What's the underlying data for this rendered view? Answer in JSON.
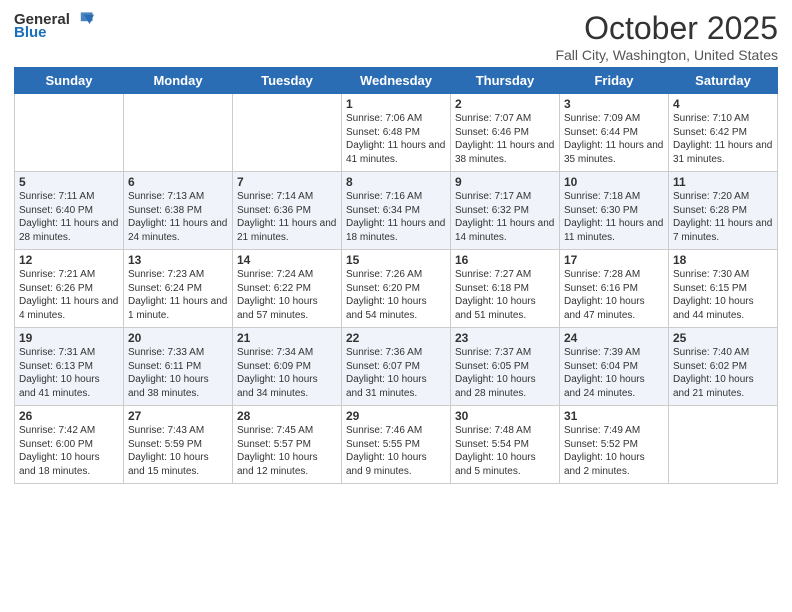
{
  "header": {
    "logo_general": "General",
    "logo_blue": "Blue",
    "month": "October 2025",
    "location": "Fall City, Washington, United States"
  },
  "weekdays": [
    "Sunday",
    "Monday",
    "Tuesday",
    "Wednesday",
    "Thursday",
    "Friday",
    "Saturday"
  ],
  "weeks": [
    [
      {
        "day": "",
        "info": ""
      },
      {
        "day": "",
        "info": ""
      },
      {
        "day": "",
        "info": ""
      },
      {
        "day": "1",
        "info": "Sunrise: 7:06 AM\nSunset: 6:48 PM\nDaylight: 11 hours and 41 minutes."
      },
      {
        "day": "2",
        "info": "Sunrise: 7:07 AM\nSunset: 6:46 PM\nDaylight: 11 hours and 38 minutes."
      },
      {
        "day": "3",
        "info": "Sunrise: 7:09 AM\nSunset: 6:44 PM\nDaylight: 11 hours and 35 minutes."
      },
      {
        "day": "4",
        "info": "Sunrise: 7:10 AM\nSunset: 6:42 PM\nDaylight: 11 hours and 31 minutes."
      }
    ],
    [
      {
        "day": "5",
        "info": "Sunrise: 7:11 AM\nSunset: 6:40 PM\nDaylight: 11 hours and 28 minutes."
      },
      {
        "day": "6",
        "info": "Sunrise: 7:13 AM\nSunset: 6:38 PM\nDaylight: 11 hours and 24 minutes."
      },
      {
        "day": "7",
        "info": "Sunrise: 7:14 AM\nSunset: 6:36 PM\nDaylight: 11 hours and 21 minutes."
      },
      {
        "day": "8",
        "info": "Sunrise: 7:16 AM\nSunset: 6:34 PM\nDaylight: 11 hours and 18 minutes."
      },
      {
        "day": "9",
        "info": "Sunrise: 7:17 AM\nSunset: 6:32 PM\nDaylight: 11 hours and 14 minutes."
      },
      {
        "day": "10",
        "info": "Sunrise: 7:18 AM\nSunset: 6:30 PM\nDaylight: 11 hours and 11 minutes."
      },
      {
        "day": "11",
        "info": "Sunrise: 7:20 AM\nSunset: 6:28 PM\nDaylight: 11 hours and 7 minutes."
      }
    ],
    [
      {
        "day": "12",
        "info": "Sunrise: 7:21 AM\nSunset: 6:26 PM\nDaylight: 11 hours and 4 minutes."
      },
      {
        "day": "13",
        "info": "Sunrise: 7:23 AM\nSunset: 6:24 PM\nDaylight: 11 hours and 1 minute."
      },
      {
        "day": "14",
        "info": "Sunrise: 7:24 AM\nSunset: 6:22 PM\nDaylight: 10 hours and 57 minutes."
      },
      {
        "day": "15",
        "info": "Sunrise: 7:26 AM\nSunset: 6:20 PM\nDaylight: 10 hours and 54 minutes."
      },
      {
        "day": "16",
        "info": "Sunrise: 7:27 AM\nSunset: 6:18 PM\nDaylight: 10 hours and 51 minutes."
      },
      {
        "day": "17",
        "info": "Sunrise: 7:28 AM\nSunset: 6:16 PM\nDaylight: 10 hours and 47 minutes."
      },
      {
        "day": "18",
        "info": "Sunrise: 7:30 AM\nSunset: 6:15 PM\nDaylight: 10 hours and 44 minutes."
      }
    ],
    [
      {
        "day": "19",
        "info": "Sunrise: 7:31 AM\nSunset: 6:13 PM\nDaylight: 10 hours and 41 minutes."
      },
      {
        "day": "20",
        "info": "Sunrise: 7:33 AM\nSunset: 6:11 PM\nDaylight: 10 hours and 38 minutes."
      },
      {
        "day": "21",
        "info": "Sunrise: 7:34 AM\nSunset: 6:09 PM\nDaylight: 10 hours and 34 minutes."
      },
      {
        "day": "22",
        "info": "Sunrise: 7:36 AM\nSunset: 6:07 PM\nDaylight: 10 hours and 31 minutes."
      },
      {
        "day": "23",
        "info": "Sunrise: 7:37 AM\nSunset: 6:05 PM\nDaylight: 10 hours and 28 minutes."
      },
      {
        "day": "24",
        "info": "Sunrise: 7:39 AM\nSunset: 6:04 PM\nDaylight: 10 hours and 24 minutes."
      },
      {
        "day": "25",
        "info": "Sunrise: 7:40 AM\nSunset: 6:02 PM\nDaylight: 10 hours and 21 minutes."
      }
    ],
    [
      {
        "day": "26",
        "info": "Sunrise: 7:42 AM\nSunset: 6:00 PM\nDaylight: 10 hours and 18 minutes."
      },
      {
        "day": "27",
        "info": "Sunrise: 7:43 AM\nSunset: 5:59 PM\nDaylight: 10 hours and 15 minutes."
      },
      {
        "day": "28",
        "info": "Sunrise: 7:45 AM\nSunset: 5:57 PM\nDaylight: 10 hours and 12 minutes."
      },
      {
        "day": "29",
        "info": "Sunrise: 7:46 AM\nSunset: 5:55 PM\nDaylight: 10 hours and 9 minutes."
      },
      {
        "day": "30",
        "info": "Sunrise: 7:48 AM\nSunset: 5:54 PM\nDaylight: 10 hours and 5 minutes."
      },
      {
        "day": "31",
        "info": "Sunrise: 7:49 AM\nSunset: 5:52 PM\nDaylight: 10 hours and 2 minutes."
      },
      {
        "day": "",
        "info": ""
      }
    ]
  ]
}
